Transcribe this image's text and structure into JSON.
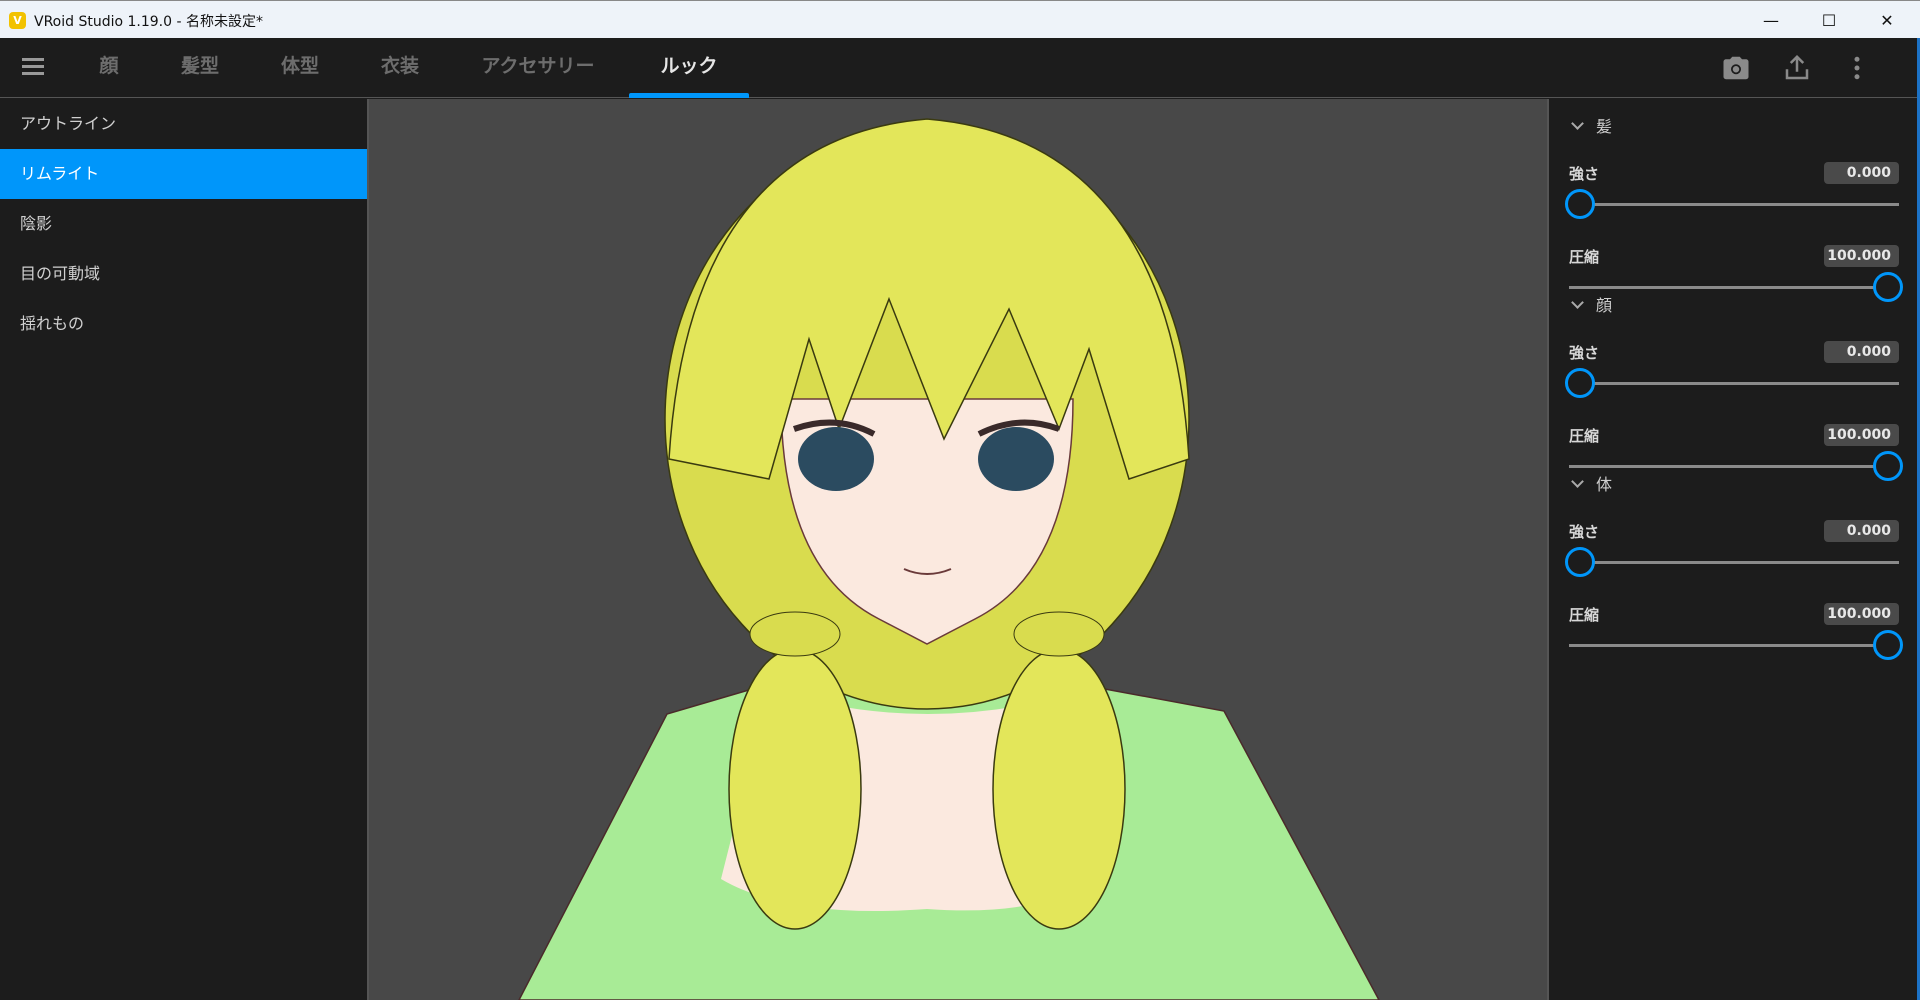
{
  "window": {
    "title": "VRoid Studio 1.19.0 - 名称未設定*",
    "logo": "V",
    "minimize": "—",
    "maximize": "☐",
    "close": "✕"
  },
  "nav": {
    "tabs": [
      {
        "label": "顔"
      },
      {
        "label": "髪型"
      },
      {
        "label": "体型"
      },
      {
        "label": "衣装"
      },
      {
        "label": "アクセサリー"
      },
      {
        "label": "ルック"
      }
    ],
    "active": "ルック",
    "icons": [
      "camera-icon",
      "export-icon",
      "more-vertical-icon"
    ]
  },
  "sidebar": {
    "items": [
      {
        "label": "アウトライン"
      },
      {
        "label": "リムライト"
      },
      {
        "label": "陰影"
      },
      {
        "label": "目の可動域"
      },
      {
        "label": "揺れもの"
      }
    ],
    "selected": "リムライト"
  },
  "panel": {
    "sections": [
      {
        "title": "髪",
        "strength_label": "強さ",
        "strength": "0.000",
        "strength_fraction": 0,
        "compress_label": "圧縮",
        "compress": "100.000",
        "compress_fraction": 1
      },
      {
        "title": "顔",
        "strength_label": "強さ",
        "strength": "0.000",
        "strength_fraction": 0,
        "compress_label": "圧縮",
        "compress": "100.000",
        "compress_fraction": 1
      },
      {
        "title": "体",
        "strength_label": "強さ",
        "strength": "0.000",
        "strength_fraction": 0,
        "compress_label": "圧縮",
        "compress": "100.000",
        "compress_fraction": 1
      }
    ]
  },
  "colors": {
    "accent": "#0096fa",
    "hair": "#e3e65a",
    "shirt": "#a8eb96",
    "skin": "#fbe9df"
  }
}
